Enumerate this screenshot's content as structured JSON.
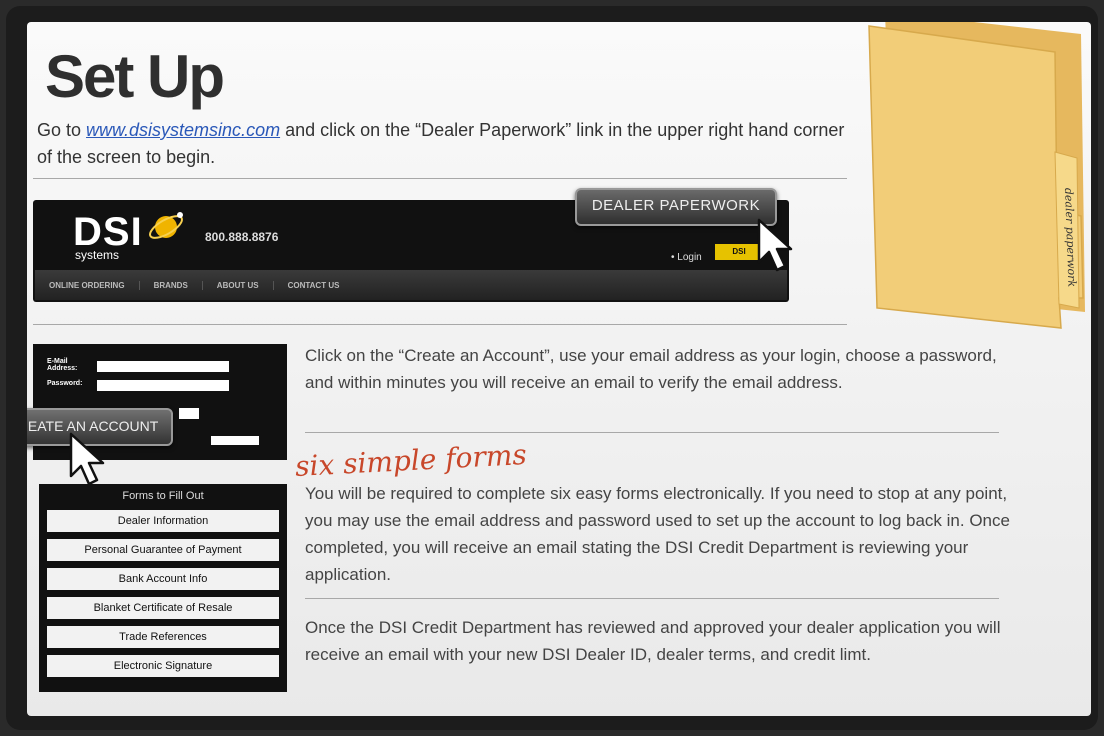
{
  "title": "Set Up",
  "intro": {
    "prefix": "Go to ",
    "link": "www.dsisystemsinc.com",
    "suffix": " and click on the “Dealer Paperwork” link in the upper right hand corner of the screen to begin."
  },
  "site": {
    "logo": "DSI",
    "logo_sub": "systems",
    "phone": "800.888.8876",
    "login": "• Login",
    "nav": [
      "ONLINE ORDERING",
      "BRANDS",
      "ABOUT US",
      "CONTACT US"
    ],
    "dealer_paperwork_button": "DEALER PAPERWORK"
  },
  "login_box": {
    "email_label": "E-Mail Address:",
    "password_label": "Password:",
    "create_account_button": "CREATE AN ACCOUNT"
  },
  "step2_text": "Click on the “Create an Account”, use your email address as your login, choose a password, and within minutes you will receive an email to verify the email address.",
  "six_forms_heading": "six simple forms",
  "step3_text": "You will be required to complete six easy forms electronically. If you need to stop at any point, you may use the email address and password used to set up the account to log back in. Once completed, you will receive an email stating the DSI Credit Department is reviewing your application.",
  "step4_text": "Once the DSI Credit Department has reviewed and approved your dealer application you will receive an email with your new DSI Dealer ID, dealer terms, and credit limt.",
  "forms": {
    "title": "Forms to Fill Out",
    "items": [
      "Dealer Information",
      "Personal Guarantee of Payment",
      "Bank Account Info",
      "Blanket Certificate of Resale",
      "Trade References",
      "Electronic Signature"
    ]
  },
  "folder_tab": "dealer paperwork",
  "colors": {
    "accent": "#c8472a",
    "link": "#2a58b8",
    "folder": "#f2cd78"
  }
}
